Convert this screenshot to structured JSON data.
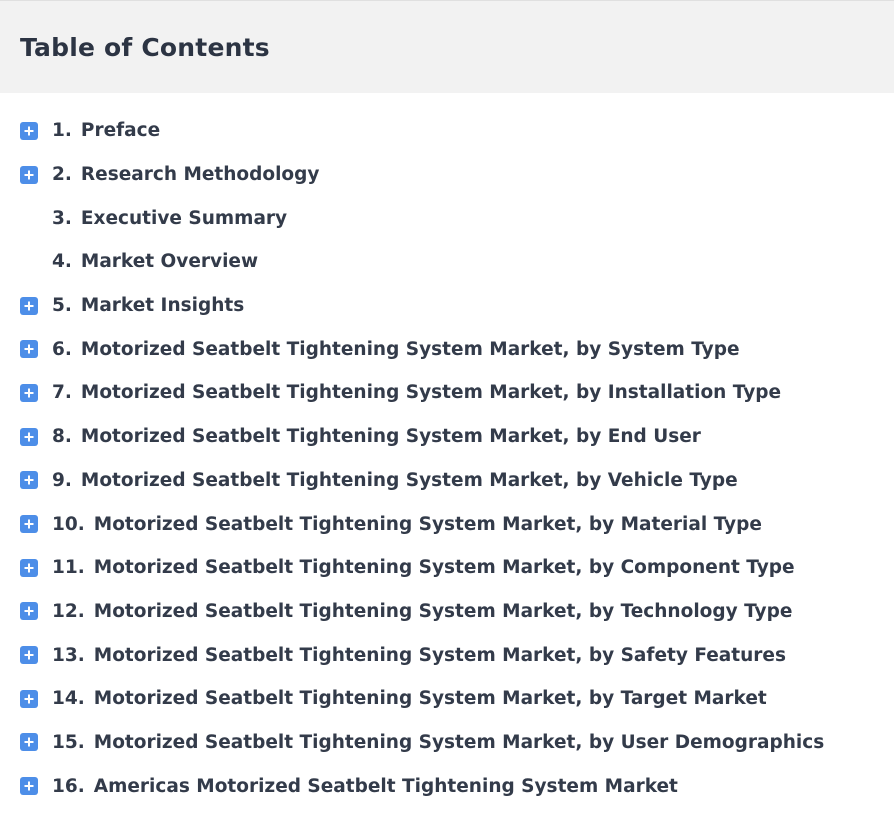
{
  "header": {
    "title": "Table of Contents"
  },
  "colors": {
    "icon_bg": "#4d8ee8",
    "header_bg": "#f2f2f2",
    "text": "#333b4a"
  },
  "toc": {
    "items": [
      {
        "num": "1.",
        "label": "Preface",
        "expandable": true,
        "icon": "plus-icon"
      },
      {
        "num": "2.",
        "label": "Research Methodology",
        "expandable": true,
        "icon": "plus-icon"
      },
      {
        "num": "3.",
        "label": "Executive Summary",
        "expandable": false
      },
      {
        "num": "4.",
        "label": "Market Overview",
        "expandable": false
      },
      {
        "num": "5.",
        "label": "Market Insights",
        "expandable": true,
        "icon": "plus-icon"
      },
      {
        "num": "6.",
        "label": "Motorized Seatbelt Tightening System Market, by System Type",
        "expandable": true,
        "icon": "plus-icon"
      },
      {
        "num": "7.",
        "label": "Motorized Seatbelt Tightening System Market, by Installation Type",
        "expandable": true,
        "icon": "plus-icon"
      },
      {
        "num": "8.",
        "label": "Motorized Seatbelt Tightening System Market, by End User",
        "expandable": true,
        "icon": "plus-icon"
      },
      {
        "num": "9.",
        "label": "Motorized Seatbelt Tightening System Market, by Vehicle Type",
        "expandable": true,
        "icon": "plus-icon"
      },
      {
        "num": "10.",
        "label": "Motorized Seatbelt Tightening System Market, by Material Type",
        "expandable": true,
        "icon": "plus-icon"
      },
      {
        "num": "11.",
        "label": "Motorized Seatbelt Tightening System Market, by Component Type",
        "expandable": true,
        "icon": "plus-icon"
      },
      {
        "num": "12.",
        "label": "Motorized Seatbelt Tightening System Market, by Technology Type",
        "expandable": true,
        "icon": "plus-icon"
      },
      {
        "num": "13.",
        "label": "Motorized Seatbelt Tightening System Market, by Safety Features",
        "expandable": true,
        "icon": "plus-icon"
      },
      {
        "num": "14.",
        "label": "Motorized Seatbelt Tightening System Market, by Target Market",
        "expandable": true,
        "icon": "plus-icon"
      },
      {
        "num": "15.",
        "label": "Motorized Seatbelt Tightening System Market, by User Demographics",
        "expandable": true,
        "icon": "plus-icon"
      },
      {
        "num": "16.",
        "label": "Americas Motorized Seatbelt Tightening System Market",
        "expandable": true,
        "icon": "plus-icon"
      }
    ]
  }
}
